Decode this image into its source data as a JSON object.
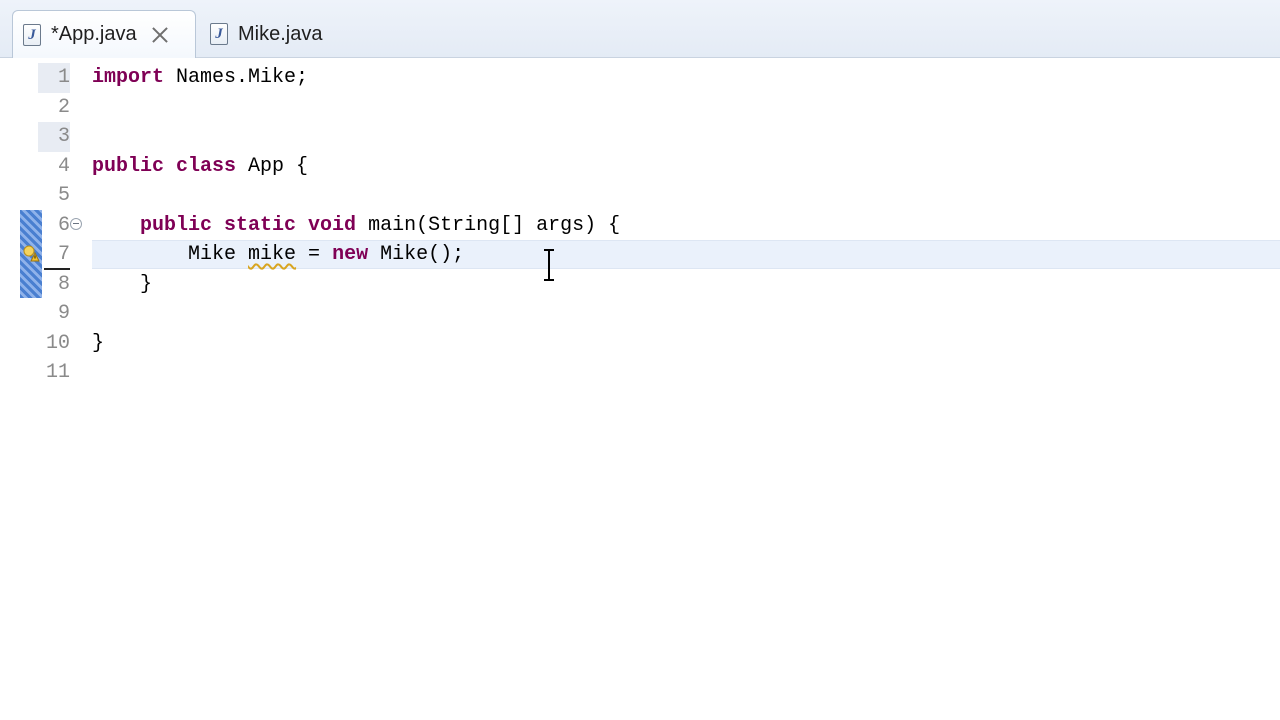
{
  "tabs": [
    {
      "label": "*App.java",
      "active": true,
      "closable": true
    },
    {
      "label": "Mike.java",
      "active": false,
      "closable": false
    }
  ],
  "icons": {
    "java_file_icon_glyph": "J",
    "tab_close": "close-icon",
    "fold": "minus-circle-icon",
    "warning": "warning-icon",
    "cursor": "ibeam-cursor-icon"
  },
  "colors": {
    "keyword": "#7f0055",
    "line_number": "#8a8a8a",
    "change_marker": "#4a7fd0",
    "current_line": "#eaf1fb"
  },
  "editor": {
    "line_numbers": [
      "1",
      "2",
      "3",
      "4",
      "5",
      "6",
      "7",
      "8",
      "9",
      "10",
      "11"
    ],
    "current_line": 7,
    "lines": [
      {
        "kw": "import",
        "rest": " Names.Mike;"
      },
      {
        "kw": "",
        "rest": ""
      },
      {
        "kw": "",
        "rest": ""
      },
      {
        "kw": "public class",
        "rest": " App {"
      },
      {
        "kw": "",
        "rest": ""
      },
      {
        "indent": "    ",
        "kw": "public static void",
        "rest": " main(String[] args) {"
      },
      {
        "indent": "        ",
        "pre": "Mike ",
        "squiggle": "mike",
        "post": " = ",
        "kw2": "new",
        "rest": " Mike();"
      },
      {
        "indent": "    ",
        "rest": "}"
      },
      {
        "kw": "",
        "rest": ""
      },
      {
        "rest": "}"
      },
      {
        "rest": ""
      }
    ]
  }
}
